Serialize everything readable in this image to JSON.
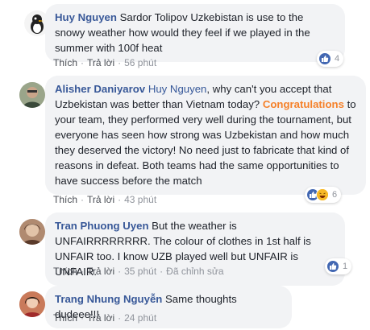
{
  "comments": [
    {
      "author": "Huy Nguyen",
      "text": "Sardor Tolipov Uzkebistan is use to the snowy weather how would they feel if we played in the summer with 100f heat",
      "like_label": "Thích",
      "reply_label": "Trả lời",
      "time": "56 phút",
      "reaction_count": "4",
      "reaction_icons": [
        "like-icon"
      ]
    },
    {
      "author": "Alisher Daniyarov",
      "mention": "Huy Nguyen",
      "text_after_mention": ", why can't you accept that Uzbekistan was better than Vietnam today?",
      "highlight": "Congratulations",
      "text_after_highlight": " to your team, they performed very well during the tournament, but everyone has seen how strong was Uzbekistan and how much they deserved the victory! No need just to fabricate that kind of reasons in defeat. Both teams had the same opportunities to have success before the match",
      "like_label": "Thích",
      "reply_label": "Trả lời",
      "time": "43 phút",
      "reaction_count": "6",
      "reaction_icons": [
        "like-icon",
        "haha-icon"
      ]
    },
    {
      "author": "Tran Phuong Uyen",
      "text": "But the weather is UNFAIRRRRRRRR. The colour of clothes in 1st half is UNFAIR too. I know UZB played well but UNFAIR is UNFAIR.",
      "like_label": "Thích",
      "reply_label": "Trả lời",
      "time": "35 phút",
      "edited_label": "Đã chỉnh sửa",
      "reaction_count": "1",
      "reaction_icons": [
        "like-icon"
      ]
    },
    {
      "author": "Trang Nhung Nguyễn",
      "text": "Same thoughts dudeee!!!",
      "like_label": "Thích",
      "reply_label": "Trả lời",
      "time": "24 phút"
    }
  ],
  "colors": {
    "author": "#385898",
    "highlight": "#f5812a",
    "bubble": "#f2f3f5",
    "like_blue": "#4267b2"
  }
}
